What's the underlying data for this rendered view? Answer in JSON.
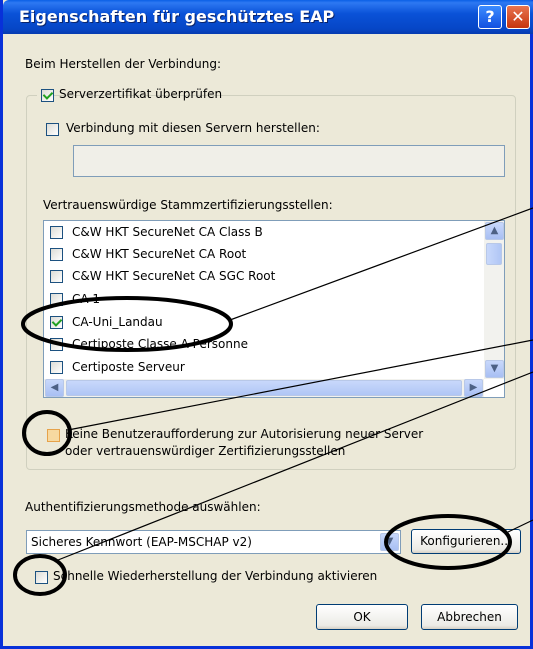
{
  "window": {
    "title": "Eigenschaften für geschütztes EAP",
    "help_label": "?",
    "close_label": "✕"
  },
  "connection": {
    "heading": "Beim Herstellen der Verbindung:",
    "verify_cert_label": "Serverzertifikat überprüfen",
    "verify_cert_checked": true,
    "connect_servers_label": "Verbindung mit diesen Servern herstellen:",
    "connect_servers_checked": false,
    "servers_value": ""
  },
  "trusted_roots": {
    "heading": "Vertrauenswürdige Stammzertifizierungsstellen:",
    "items": [
      {
        "label": "C&W HKT SecureNet CA Class B",
        "checked": false
      },
      {
        "label": "C&W HKT SecureNet CA Root",
        "checked": false
      },
      {
        "label": "C&W HKT SecureNet CA SGC Root",
        "checked": false
      },
      {
        "label": "CA 1",
        "checked": false
      },
      {
        "label": "CA-Uni_Landau",
        "checked": true
      },
      {
        "label": "Certiposte Classe A Personne",
        "checked": false
      },
      {
        "label": "Certiposte Serveur",
        "checked": false
      }
    ]
  },
  "no_prompt": {
    "label_line1": "Keine Benutzeraufforderung zur Autorisierung neuer Server",
    "label_line2": "oder vertrauenswürdiger Zertifizierungsstellen",
    "checked": false
  },
  "auth": {
    "heading": "Authentifizierungsmethode auswählen:",
    "selected": "Sicheres Kennwort (EAP-MSCHAP v2)",
    "configure_label": "Konfigurieren..."
  },
  "fast_reconnect": {
    "label": "Schnelle Wiederherstellung der Verbindung aktivieren",
    "checked": false
  },
  "footer": {
    "ok_label": "OK",
    "cancel_label": "Abbrechen"
  },
  "icons": {
    "scroll_up": "▲",
    "scroll_down": "▼",
    "scroll_left": "◀",
    "scroll_right": "▶",
    "dropdown": "▼"
  }
}
